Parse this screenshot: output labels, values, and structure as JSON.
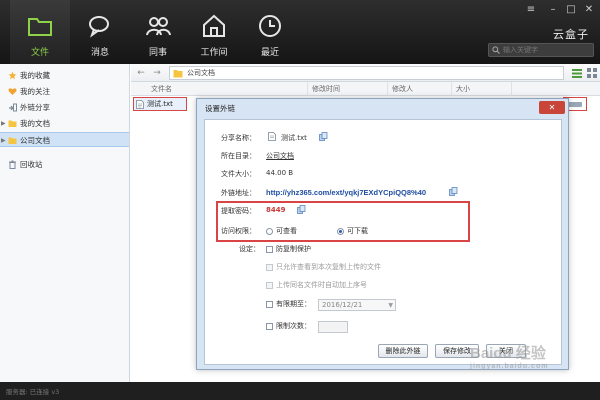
{
  "header": {
    "nav": [
      {
        "label": "文件",
        "icon": "folder-icon"
      },
      {
        "label": "消息",
        "icon": "chat-icon"
      },
      {
        "label": "同事",
        "icon": "people-icon"
      },
      {
        "label": "工作间",
        "icon": "house-icon"
      },
      {
        "label": "最近",
        "icon": "clock-icon"
      }
    ],
    "brand": "云盒子",
    "search_placeholder": "输入关键字"
  },
  "sidebar": {
    "items": [
      {
        "label": "我的收藏"
      },
      {
        "label": "我的关注"
      },
      {
        "label": "外链分享"
      },
      {
        "label": "我的文档"
      },
      {
        "label": "公司文档"
      },
      {
        "label": "回收站"
      }
    ]
  },
  "toolbar": {
    "path": "公司文档"
  },
  "columns": [
    "文件名",
    "修改时间",
    "修改人",
    "大小"
  ],
  "file": {
    "name": "测试.txt"
  },
  "dialog": {
    "title": "设置外链",
    "close": "✕",
    "share_name_label": "分享名称：",
    "share_name": "测试.txt",
    "dir_label": "所在目录：",
    "dir": "公司文档",
    "size_label": "文件大小：",
    "size": "44.00 B",
    "link_label": "外链地址：",
    "link": "http://yhz365.com/ext/yqkj7EXdYCpiQQ8%40",
    "code_label": "提取密码：",
    "code": "8449",
    "perm_label": "访问权限：",
    "perm_view": "可查看",
    "perm_download": "可下载",
    "settings_label": "设定：",
    "opt_protect": "防复制保护",
    "opt_first": "只允许查看到本次复制上传的文件",
    "opt_rename": "上传同名文件时自动加上序号",
    "opt_expire": "有限期至：",
    "expire_date": "2016/12/21",
    "opt_limit": "限制次数：",
    "btn_delete": "删除此外链",
    "btn_save": "保存修改",
    "btn_close": "关闭"
  },
  "watermark": {
    "text": "Baidu 经验",
    "sub": "jingyan.baidu.com"
  },
  "statusbar": {
    "text": "服务器: 已连接 v3"
  }
}
